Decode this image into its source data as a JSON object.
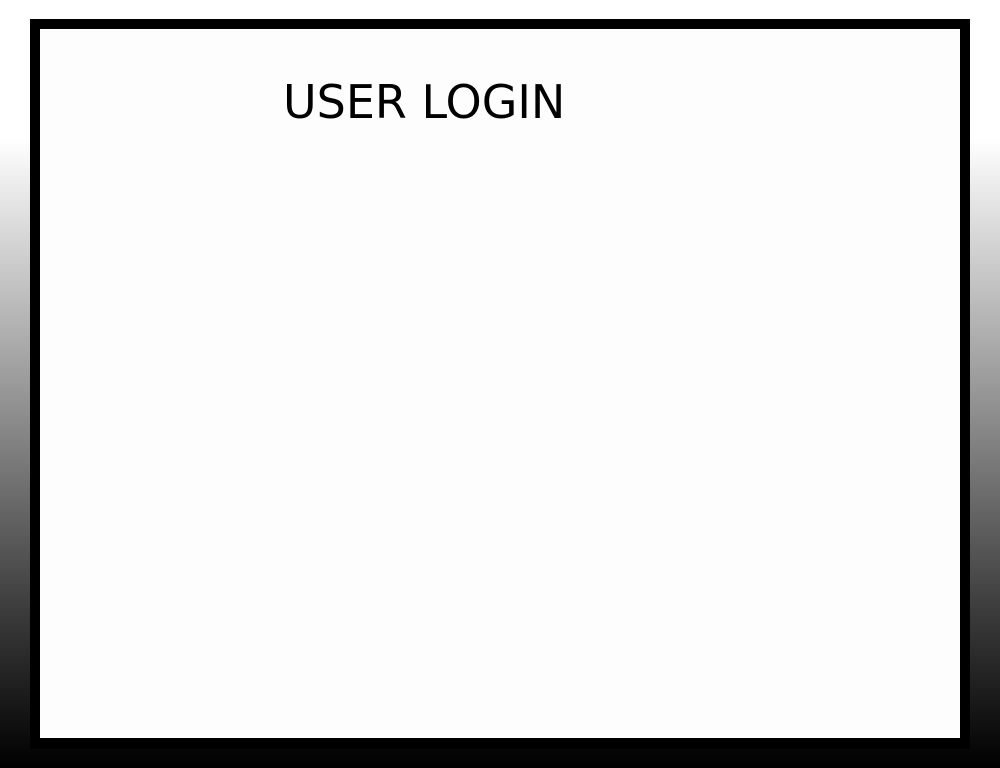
{
  "page": {
    "title": "USER LOGIN"
  },
  "colors": {
    "frame": "#000000",
    "panel_background": "#fefdfd",
    "title_text": "#000000"
  }
}
